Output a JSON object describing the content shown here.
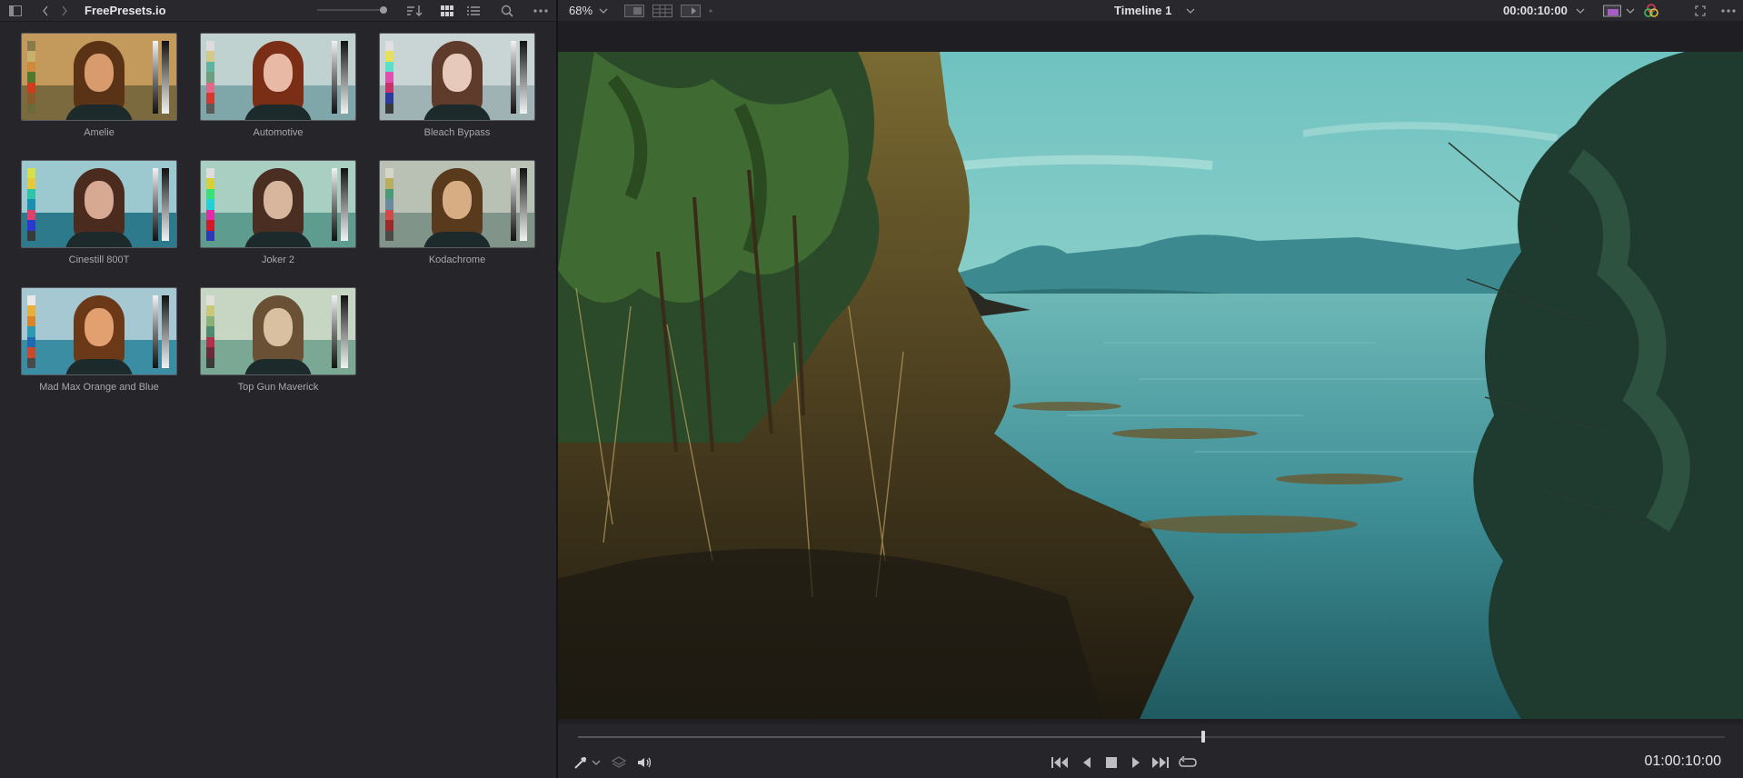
{
  "left_panel": {
    "title": "FreePresets.io",
    "presets": [
      {
        "name": "Amelie",
        "tone": [
          "#c49a5c",
          "#7a6a3d"
        ],
        "skin": "#d89b6d",
        "hair": "#5a3216",
        "bars": [
          "#8c7a4a",
          "#c6b26a",
          "#cf8a3a",
          "#4f7a2e",
          "#d23a1e",
          "#8a5a2a",
          "#6a6a3a"
        ]
      },
      {
        "name": "Automotive",
        "tone": [
          "#bfd2d0",
          "#7fa6a8"
        ],
        "skin": "#e8b9a4",
        "hair": "#7a2e16",
        "bars": [
          "#dcdcdc",
          "#d4c98a",
          "#5fb3a0",
          "#6f9e7c",
          "#e06a8a",
          "#d13a2e",
          "#5b5b5b"
        ]
      },
      {
        "name": "Bleach Bypass",
        "tone": [
          "#c9d4d4",
          "#9fb2b4"
        ],
        "skin": "#e6c9bb",
        "hair": "#5e3b2a",
        "bars": [
          "#e0e0e0",
          "#e8df5a",
          "#59e0c8",
          "#e04fb0",
          "#c8326a",
          "#2c3a9a",
          "#3a3a3a"
        ]
      },
      {
        "name": "Cinestill 800T",
        "tone": [
          "#9cc9d0",
          "#2d7a8c"
        ],
        "skin": "#d7a892",
        "hair": "#4a2b1e",
        "bars": [
          "#d5e04a",
          "#e6c93a",
          "#2ec4a6",
          "#1b8fb0",
          "#e0406a",
          "#2a3ad0",
          "#3a3a3a"
        ]
      },
      {
        "name": "Joker 2",
        "tone": [
          "#a9cfc2",
          "#5d9c8e"
        ],
        "skin": "#d8b59d",
        "hair": "#4a2e22",
        "bars": [
          "#ddd",
          "#d8d03a",
          "#3ae078",
          "#22d0d6",
          "#e02ca6",
          "#d01a2a",
          "#2a3ab0"
        ]
      },
      {
        "name": "Kodachrome",
        "tone": [
          "#b9c1b4",
          "#80948a"
        ],
        "skin": "#d7ae84",
        "hair": "#5a3a1c",
        "bars": [
          "#d6d6c8",
          "#b8b060",
          "#4a9a7a",
          "#6a8aa0",
          "#d04a4a",
          "#9a2a2a",
          "#4a4a4a"
        ]
      },
      {
        "name": "Mad Max Orange and Blue",
        "tone": [
          "#a6c8d2",
          "#3b8da3"
        ],
        "skin": "#e2a070",
        "hair": "#6b3818",
        "bars": [
          "#e8e8e8",
          "#e8b03a",
          "#d9832a",
          "#2e9ab0",
          "#1e6ab0",
          "#c84a2a",
          "#4a4a4a"
        ]
      },
      {
        "name": "Top Gun Maverick",
        "tone": [
          "#c6d6c2",
          "#7aa894"
        ],
        "skin": "#d9c0a0",
        "hair": "#6a5034",
        "bars": [
          "#e0e0d8",
          "#c9c77a",
          "#8ab07a",
          "#4e8a6e",
          "#b0324a",
          "#6a2a3a",
          "#3a3a3a"
        ]
      }
    ]
  },
  "viewer_header": {
    "zoom": "68%",
    "timeline_name": "Timeline 1",
    "duration": "00:00:10:00"
  },
  "transport": {
    "timecode": "01:00:10:00",
    "progress": 0.545
  }
}
